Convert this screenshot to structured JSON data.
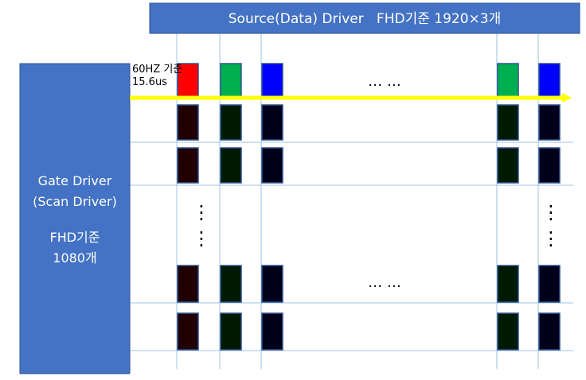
{
  "source_driver": {
    "label": "Source(Data) Driver   FHD기준 1920×3개"
  },
  "gate_driver": {
    "line1": "Gate Driver",
    "line2": "(Scan Driver)",
    "line3": "FHD기준",
    "line4": "1080개"
  },
  "timing_label": {
    "line1": "60HZ 기준",
    "line2": "15.6us"
  },
  "ellipsis_top": "… …",
  "ellipsis_bottom": "… …",
  "vertical_dots": "⋮",
  "colors": {
    "driver_fill": "#4472c4",
    "driver_border": "#2f528f",
    "scan_line": "#ffff00",
    "grid_line": "#9dc3e6",
    "pixel_border": "#2f528f",
    "red_active": "#ff0000",
    "green_active": "#00b050",
    "blue_active": "#0000ff",
    "red_dim": "#200000",
    "green_dim": "#001a00",
    "blue_dim": "#00001a"
  }
}
